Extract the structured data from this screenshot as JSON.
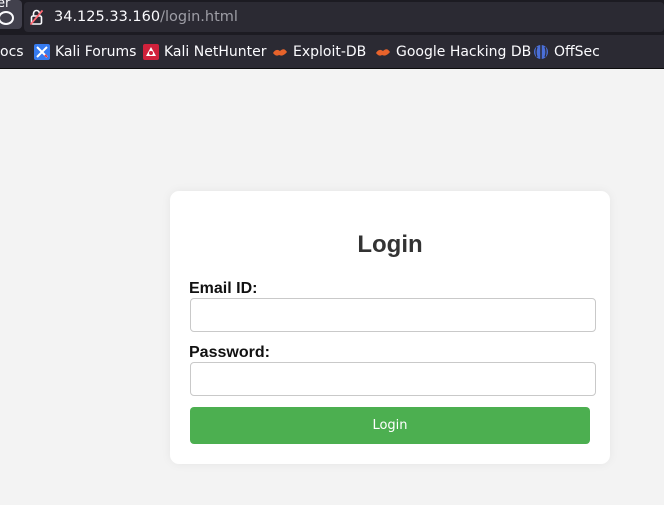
{
  "browser": {
    "prev_button_text": "er",
    "url_host": "34.125.33.160",
    "url_path": "/login.html"
  },
  "bookmarks": [
    {
      "label": "ocs",
      "icon": "docs-icon"
    },
    {
      "label": "Kali Forums",
      "icon": "kali-forums-icon"
    },
    {
      "label": "Kali NetHunter",
      "icon": "kali-nethunter-icon"
    },
    {
      "label": "Exploit-DB",
      "icon": "exploit-db-icon"
    },
    {
      "label": "Google Hacking DB",
      "icon": "ghdb-icon"
    },
    {
      "label": "OffSec",
      "icon": "offsec-icon"
    }
  ],
  "login": {
    "title": "Login",
    "email_label": "Email ID:",
    "email_value": "",
    "password_label": "Password:",
    "password_value": "",
    "button_label": "Login"
  },
  "colors": {
    "button": "#4caf50",
    "page_background": "#f3f3f3",
    "card_background": "#ffffff",
    "toolbar": "#2b2a33"
  }
}
